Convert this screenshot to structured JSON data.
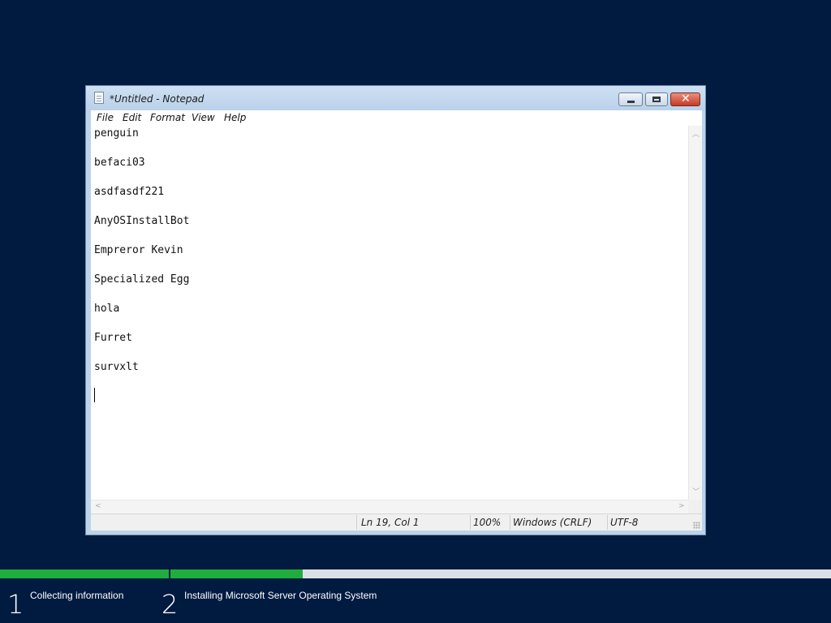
{
  "window": {
    "title": "*Untitled - Notepad",
    "buttons": {
      "minimize": "minimize",
      "maximize": "maximize",
      "close": "✕"
    }
  },
  "menu": [
    "File",
    "Edit",
    "Format",
    "View",
    "Help"
  ],
  "document": {
    "lines": [
      "penguin",
      "befaci03",
      "asdfasdf221",
      "AnyOSInstallBot",
      "Empreror Kevin",
      "Specialized Egg",
      "hola",
      "Furret",
      "survxlt"
    ]
  },
  "status": {
    "position": "Ln 19, Col 1",
    "zoom": "100%",
    "line_endings": "Windows (CRLF)",
    "encoding": "UTF-8"
  },
  "setup": {
    "progress": {
      "step1_fraction": 1.0,
      "step2_fraction": 0.2
    },
    "steps": [
      {
        "number": "1",
        "label": "Collecting information"
      },
      {
        "number": "2",
        "label": "Installing Microsoft Server Operating System"
      }
    ]
  },
  "colors": {
    "background": "#001a40",
    "progress_fill": "#1fad3e",
    "progress_track": "#dbe0e6"
  }
}
